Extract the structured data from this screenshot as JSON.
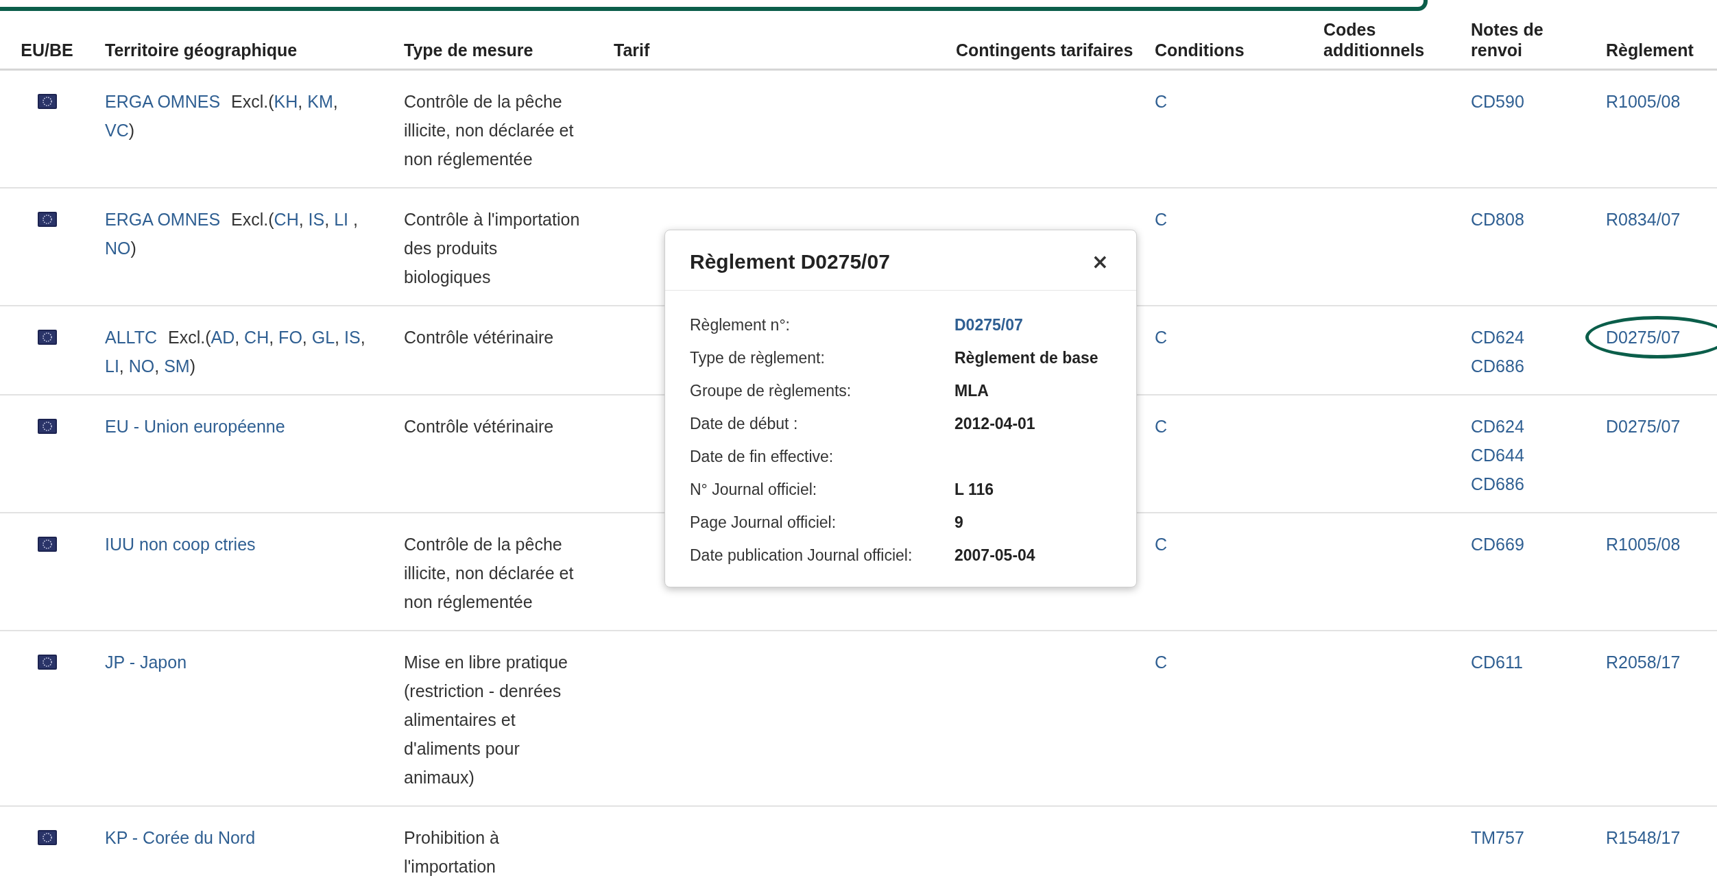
{
  "table": {
    "columns": [
      "EU/BE",
      "Territoire géographique",
      "Type de mesure",
      "Tarif",
      "Contingents tarifaires",
      "Conditions",
      "Codes additionnels",
      "Notes de renvoi",
      "Règlement"
    ],
    "rows": [
      {
        "territory": [
          {
            "kind": "link",
            "text": "ERGA OMNES"
          },
          {
            "kind": "prefix",
            "text": "Excl.("
          },
          {
            "kind": "link",
            "text": "KH"
          },
          {
            "kind": "text",
            "text": ", "
          },
          {
            "kind": "link",
            "text": "KM"
          },
          {
            "kind": "text",
            "text": ", "
          },
          {
            "kind": "link",
            "text": "VC"
          },
          {
            "kind": "text",
            "text": ")"
          }
        ],
        "measure_type": "Contrôle de la pêche illicite, non déclarée et non réglementée",
        "conditions": "C",
        "footnotes": [
          "CD590"
        ],
        "regulation": "R1005/08",
        "circled": false
      },
      {
        "territory": [
          {
            "kind": "link",
            "text": "ERGA OMNES"
          },
          {
            "kind": "prefix",
            "text": "Excl.("
          },
          {
            "kind": "link",
            "text": "CH"
          },
          {
            "kind": "text",
            "text": ", "
          },
          {
            "kind": "link",
            "text": "IS"
          },
          {
            "kind": "text",
            "text": ", "
          },
          {
            "kind": "link",
            "text": "LI"
          },
          {
            "kind": "text",
            "text": " , "
          },
          {
            "kind": "link",
            "text": "NO"
          },
          {
            "kind": "text",
            "text": ")"
          }
        ],
        "measure_type": "Contrôle à l'importation des produits biologiques",
        "conditions": "C",
        "footnotes": [
          "CD808"
        ],
        "regulation": "R0834/07",
        "circled": false
      },
      {
        "territory": [
          {
            "kind": "link",
            "text": "ALLTC"
          },
          {
            "kind": "prefix",
            "text": "Excl.("
          },
          {
            "kind": "link",
            "text": "AD"
          },
          {
            "kind": "text",
            "text": ", "
          },
          {
            "kind": "link",
            "text": "CH"
          },
          {
            "kind": "text",
            "text": ", "
          },
          {
            "kind": "link",
            "text": "FO"
          },
          {
            "kind": "text",
            "text": ", "
          },
          {
            "kind": "link",
            "text": "GL"
          },
          {
            "kind": "text",
            "text": ", "
          },
          {
            "kind": "link",
            "text": "IS"
          },
          {
            "kind": "text",
            "text": ", "
          },
          {
            "kind": "link",
            "text": "LI"
          },
          {
            "kind": "text",
            "text": ", "
          },
          {
            "kind": "link",
            "text": "NO"
          },
          {
            "kind": "text",
            "text": ", "
          },
          {
            "kind": "link",
            "text": "SM"
          },
          {
            "kind": "text",
            "text": ")"
          }
        ],
        "measure_type": "Contrôle vétérinaire",
        "conditions": "C",
        "footnotes": [
          "CD624",
          "CD686"
        ],
        "regulation": "D0275/07",
        "circled": true
      },
      {
        "territory": [
          {
            "kind": "link",
            "text": "EU - Union européenne"
          }
        ],
        "measure_type": "Contrôle vétérinaire",
        "conditions": "C",
        "footnotes": [
          "CD624",
          "CD644",
          "CD686"
        ],
        "regulation": "D0275/07",
        "circled": false
      },
      {
        "territory": [
          {
            "kind": "link",
            "text": "IUU non coop ctries"
          }
        ],
        "measure_type": "Contrôle de la pêche illicite, non déclarée et non réglementée",
        "conditions": "C",
        "footnotes": [
          "CD669"
        ],
        "regulation": "R1005/08",
        "circled": false
      },
      {
        "territory": [
          {
            "kind": "link",
            "text": "JP - Japon"
          }
        ],
        "measure_type": "Mise en libre pratique (restriction - denrées alimentaires et d'aliments pour animaux)",
        "conditions": "C",
        "footnotes": [
          "CD611"
        ],
        "regulation": "R2058/17",
        "circled": false
      },
      {
        "territory": [
          {
            "kind": "link",
            "text": "KP - Corée du Nord"
          }
        ],
        "measure_type": "Prohibition à l'importation",
        "footnotes": [
          "TM757"
        ],
        "regulation": "R1548/17",
        "circled": false
      }
    ]
  },
  "popup": {
    "title": "Règlement D0275/07",
    "close": "×",
    "fields": [
      {
        "label": "Règlement n°:",
        "value": "D0275/07",
        "kind": "link"
      },
      {
        "label": "Type de règlement:",
        "value": "Règlement de base",
        "kind": "bold"
      },
      {
        "label": "Groupe de règlements:",
        "value": "MLA",
        "kind": "bold"
      },
      {
        "label": "Date de début :",
        "value": "2012-04-01",
        "kind": "bold"
      },
      {
        "label": "Date de fin effective:"
      },
      {
        "label": "N° Journal officiel:",
        "value": "L 116",
        "kind": "bold"
      },
      {
        "label": "Page Journal officiel:",
        "value": "9",
        "kind": "bold"
      },
      {
        "label": "Date publication Journal officiel:",
        "value": "2007-05-04",
        "kind": "bold"
      }
    ]
  }
}
